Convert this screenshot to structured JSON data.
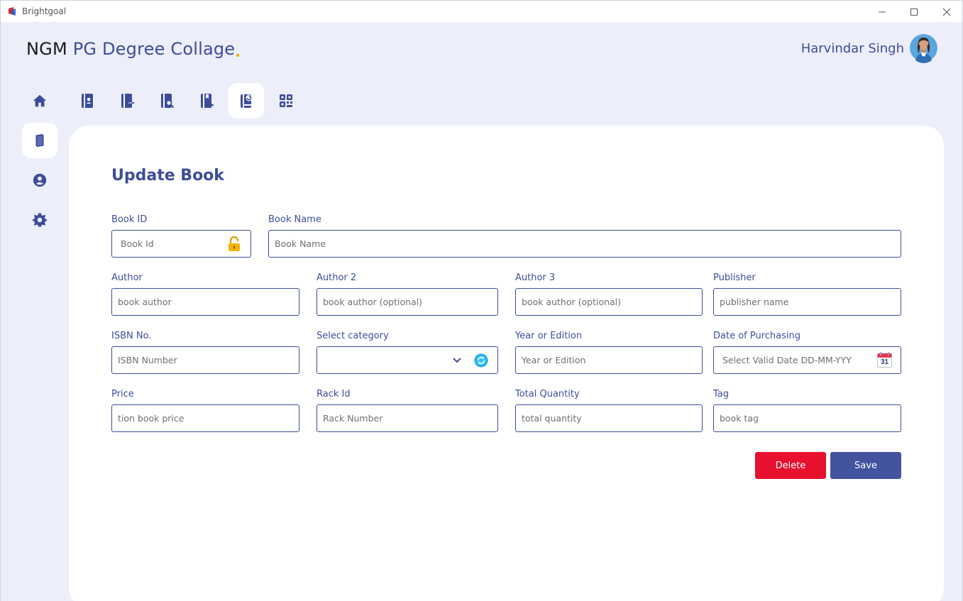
{
  "window": {
    "app_name": "Brightgoal"
  },
  "header": {
    "brand_part1": "NGM",
    "brand_part2": "PG Degree Collage",
    "user_name": "Harvindar Singh"
  },
  "side_nav": [
    "home-icon",
    "book-icon",
    "user-icon",
    "gear-icon"
  ],
  "tabs": [
    "book-user-icon",
    "book-return-icon",
    "book-search-icon",
    "book-add-icon",
    "book-update-icon",
    "book-barcode-icon"
  ],
  "form": {
    "title": "Update Book",
    "book_id": {
      "label": "Book ID",
      "placeholder": "Book Id"
    },
    "book_name": {
      "label": "Book Name",
      "placeholder": "Book Name"
    },
    "author": {
      "label": "Author",
      "placeholder": "book author"
    },
    "author2": {
      "label": "Author 2",
      "placeholder": "book author (optional)"
    },
    "author3": {
      "label": "Author 3",
      "placeholder": "book author (optional)"
    },
    "publisher": {
      "label": "Publisher",
      "placeholder": "publisher name"
    },
    "isbn": {
      "label": "ISBN No.",
      "placeholder": "ISBN Number"
    },
    "category": {
      "label": "Select category",
      "value": ""
    },
    "edition": {
      "label": "Year or Edition",
      "placeholder": "Year or Edition"
    },
    "purchase_date": {
      "label": "Date of Purchasing",
      "placeholder": "Select Valid Date DD-MM-YYY",
      "calendar_day": "31"
    },
    "price": {
      "label": "Price",
      "placeholder": "tion book price"
    },
    "rack": {
      "label": "Rack Id",
      "placeholder": "Rack Number"
    },
    "quantity": {
      "label": "Total Quantity",
      "placeholder": "total quantity"
    },
    "tag": {
      "label": "Tag",
      "placeholder": "book tag"
    }
  },
  "actions": {
    "delete": "Delete",
    "save": "Save"
  },
  "colors": {
    "accent": "#3d4d99",
    "danger": "#e8102f",
    "background": "#eceef9",
    "brand_dot": "#f2b500"
  }
}
